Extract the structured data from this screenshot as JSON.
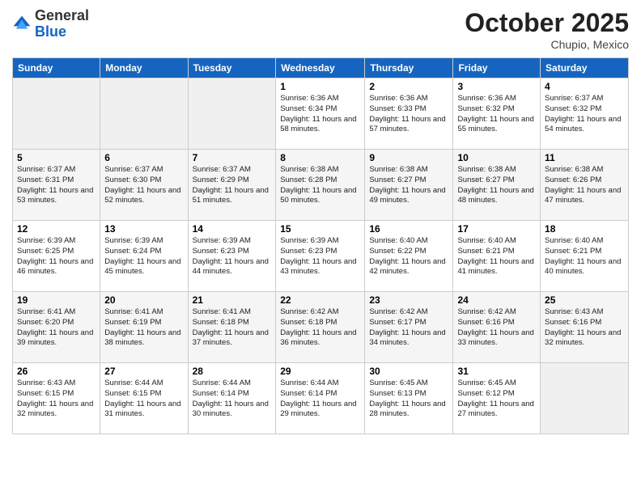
{
  "header": {
    "logo_general": "General",
    "logo_blue": "Blue",
    "month_title": "October 2025",
    "location": "Chupio, Mexico"
  },
  "days_of_week": [
    "Sunday",
    "Monday",
    "Tuesday",
    "Wednesday",
    "Thursday",
    "Friday",
    "Saturday"
  ],
  "weeks": [
    [
      {
        "day": "",
        "empty": true
      },
      {
        "day": "",
        "empty": true
      },
      {
        "day": "",
        "empty": true
      },
      {
        "day": "1",
        "sunrise": "6:36 AM",
        "sunset": "6:34 PM",
        "daylight": "11 hours and 58 minutes."
      },
      {
        "day": "2",
        "sunrise": "6:36 AM",
        "sunset": "6:33 PM",
        "daylight": "11 hours and 57 minutes."
      },
      {
        "day": "3",
        "sunrise": "6:36 AM",
        "sunset": "6:32 PM",
        "daylight": "11 hours and 55 minutes."
      },
      {
        "day": "4",
        "sunrise": "6:37 AM",
        "sunset": "6:32 PM",
        "daylight": "11 hours and 54 minutes."
      }
    ],
    [
      {
        "day": "5",
        "sunrise": "6:37 AM",
        "sunset": "6:31 PM",
        "daylight": "11 hours and 53 minutes."
      },
      {
        "day": "6",
        "sunrise": "6:37 AM",
        "sunset": "6:30 PM",
        "daylight": "11 hours and 52 minutes."
      },
      {
        "day": "7",
        "sunrise": "6:37 AM",
        "sunset": "6:29 PM",
        "daylight": "11 hours and 51 minutes."
      },
      {
        "day": "8",
        "sunrise": "6:38 AM",
        "sunset": "6:28 PM",
        "daylight": "11 hours and 50 minutes."
      },
      {
        "day": "9",
        "sunrise": "6:38 AM",
        "sunset": "6:27 PM",
        "daylight": "11 hours and 49 minutes."
      },
      {
        "day": "10",
        "sunrise": "6:38 AM",
        "sunset": "6:27 PM",
        "daylight": "11 hours and 48 minutes."
      },
      {
        "day": "11",
        "sunrise": "6:38 AM",
        "sunset": "6:26 PM",
        "daylight": "11 hours and 47 minutes."
      }
    ],
    [
      {
        "day": "12",
        "sunrise": "6:39 AM",
        "sunset": "6:25 PM",
        "daylight": "11 hours and 46 minutes."
      },
      {
        "day": "13",
        "sunrise": "6:39 AM",
        "sunset": "6:24 PM",
        "daylight": "11 hours and 45 minutes."
      },
      {
        "day": "14",
        "sunrise": "6:39 AM",
        "sunset": "6:23 PM",
        "daylight": "11 hours and 44 minutes."
      },
      {
        "day": "15",
        "sunrise": "6:39 AM",
        "sunset": "6:23 PM",
        "daylight": "11 hours and 43 minutes."
      },
      {
        "day": "16",
        "sunrise": "6:40 AM",
        "sunset": "6:22 PM",
        "daylight": "11 hours and 42 minutes."
      },
      {
        "day": "17",
        "sunrise": "6:40 AM",
        "sunset": "6:21 PM",
        "daylight": "11 hours and 41 minutes."
      },
      {
        "day": "18",
        "sunrise": "6:40 AM",
        "sunset": "6:21 PM",
        "daylight": "11 hours and 40 minutes."
      }
    ],
    [
      {
        "day": "19",
        "sunrise": "6:41 AM",
        "sunset": "6:20 PM",
        "daylight": "11 hours and 39 minutes."
      },
      {
        "day": "20",
        "sunrise": "6:41 AM",
        "sunset": "6:19 PM",
        "daylight": "11 hours and 38 minutes."
      },
      {
        "day": "21",
        "sunrise": "6:41 AM",
        "sunset": "6:18 PM",
        "daylight": "11 hours and 37 minutes."
      },
      {
        "day": "22",
        "sunrise": "6:42 AM",
        "sunset": "6:18 PM",
        "daylight": "11 hours and 36 minutes."
      },
      {
        "day": "23",
        "sunrise": "6:42 AM",
        "sunset": "6:17 PM",
        "daylight": "11 hours and 34 minutes."
      },
      {
        "day": "24",
        "sunrise": "6:42 AM",
        "sunset": "6:16 PM",
        "daylight": "11 hours and 33 minutes."
      },
      {
        "day": "25",
        "sunrise": "6:43 AM",
        "sunset": "6:16 PM",
        "daylight": "11 hours and 32 minutes."
      }
    ],
    [
      {
        "day": "26",
        "sunrise": "6:43 AM",
        "sunset": "6:15 PM",
        "daylight": "11 hours and 32 minutes."
      },
      {
        "day": "27",
        "sunrise": "6:44 AM",
        "sunset": "6:15 PM",
        "daylight": "11 hours and 31 minutes."
      },
      {
        "day": "28",
        "sunrise": "6:44 AM",
        "sunset": "6:14 PM",
        "daylight": "11 hours and 30 minutes."
      },
      {
        "day": "29",
        "sunrise": "6:44 AM",
        "sunset": "6:14 PM",
        "daylight": "11 hours and 29 minutes."
      },
      {
        "day": "30",
        "sunrise": "6:45 AM",
        "sunset": "6:13 PM",
        "daylight": "11 hours and 28 minutes."
      },
      {
        "day": "31",
        "sunrise": "6:45 AM",
        "sunset": "6:12 PM",
        "daylight": "11 hours and 27 minutes."
      },
      {
        "day": "",
        "empty": true
      }
    ]
  ],
  "labels": {
    "sunrise_prefix": "Sunrise: ",
    "sunset_prefix": "Sunset: ",
    "daylight_prefix": "Daylight: "
  }
}
